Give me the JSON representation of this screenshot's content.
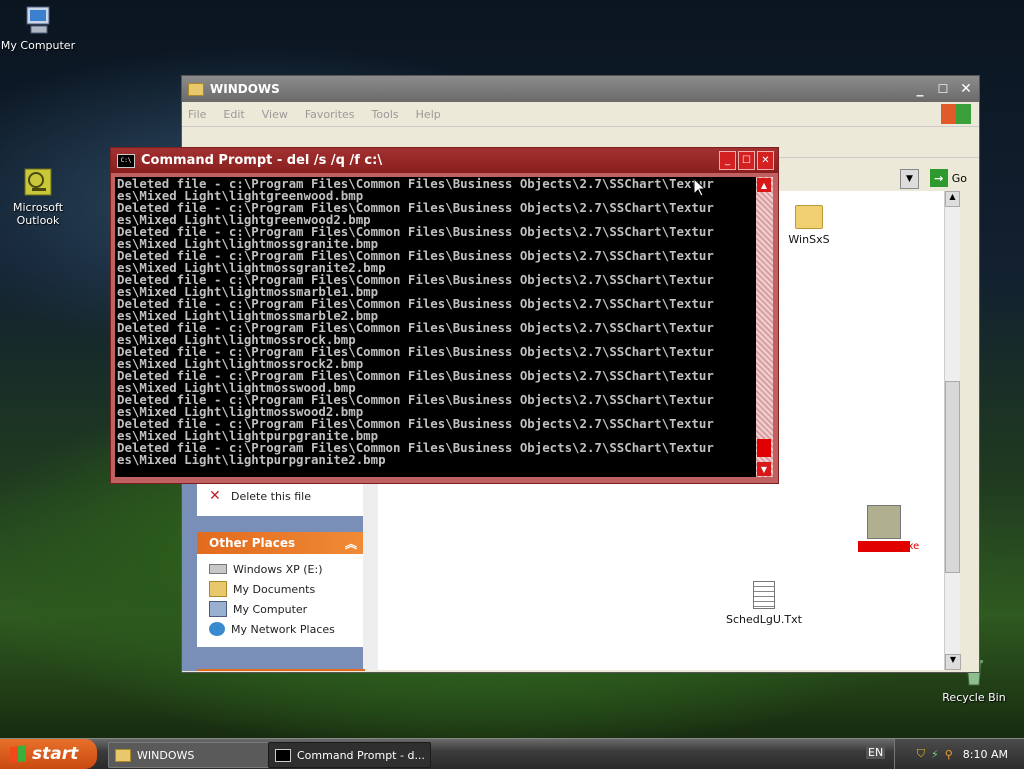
{
  "desktop": {
    "icons": [
      {
        "label": "My Computer"
      },
      {
        "label": "Microsoft Outlook"
      },
      {
        "label": "Recycle Bin"
      }
    ]
  },
  "explorer": {
    "title": "WINDOWS",
    "menu": [
      "File",
      "Edit",
      "View",
      "Favorites",
      "Tools",
      "Help"
    ],
    "address_go": "Go",
    "tasks": {
      "delete_label": "Delete this file"
    },
    "other_places": {
      "heading": "Other Places",
      "items": [
        {
          "label": "Windows XP (E:)",
          "icon": "drive-icon"
        },
        {
          "label": "My Documents",
          "icon": "documents-icon"
        },
        {
          "label": "My Computer",
          "icon": "computer-icon"
        },
        {
          "label": "My Network Places",
          "icon": "network-icon"
        }
      ]
    },
    "files": [
      {
        "name": "WinSxS",
        "type": "folder"
      },
      {
        "name": "explorer.exe",
        "type": "exe"
      },
      {
        "name": "SchedLgU.Txt",
        "type": "text"
      }
    ]
  },
  "cmd": {
    "title": "Command Prompt - del /s /q /f c:\\",
    "lines": [
      "Deleted file - c:\\Program Files\\Common Files\\Business Objects\\2.7\\SSChart\\Textur",
      "es\\Mixed Light\\lightgreenwood.bmp",
      "Deleted file - c:\\Program Files\\Common Files\\Business Objects\\2.7\\SSChart\\Textur",
      "es\\Mixed Light\\lightgreenwood2.bmp",
      "Deleted file - c:\\Program Files\\Common Files\\Business Objects\\2.7\\SSChart\\Textur",
      "es\\Mixed Light\\lightmossgranite.bmp",
      "Deleted file - c:\\Program Files\\Common Files\\Business Objects\\2.7\\SSChart\\Textur",
      "es\\Mixed Light\\lightmossgranite2.bmp",
      "Deleted file - c:\\Program Files\\Common Files\\Business Objects\\2.7\\SSChart\\Textur",
      "es\\Mixed Light\\lightmossmarble1.bmp",
      "Deleted file - c:\\Program Files\\Common Files\\Business Objects\\2.7\\SSChart\\Textur",
      "es\\Mixed Light\\lightmossmarble2.bmp",
      "Deleted file - c:\\Program Files\\Common Files\\Business Objects\\2.7\\SSChart\\Textur",
      "es\\Mixed Light\\lightmossrock.bmp",
      "Deleted file - c:\\Program Files\\Common Files\\Business Objects\\2.7\\SSChart\\Textur",
      "es\\Mixed Light\\lightmossrock2.bmp",
      "Deleted file - c:\\Program Files\\Common Files\\Business Objects\\2.7\\SSChart\\Textur",
      "es\\Mixed Light\\lightmosswood.bmp",
      "Deleted file - c:\\Program Files\\Common Files\\Business Objects\\2.7\\SSChart\\Textur",
      "es\\Mixed Light\\lightmosswood2.bmp",
      "Deleted file - c:\\Program Files\\Common Files\\Business Objects\\2.7\\SSChart\\Textur",
      "es\\Mixed Light\\lightpurpgranite.bmp",
      "Deleted file - c:\\Program Files\\Common Files\\Business Objects\\2.7\\SSChart\\Textur",
      "es\\Mixed Light\\lightpurpgranite2.bmp"
    ]
  },
  "taskbar": {
    "start_label": "start",
    "buttons": [
      {
        "label": "WINDOWS"
      },
      {
        "label": "Command Prompt - d..."
      }
    ],
    "language": "EN",
    "clock": "8:10 AM"
  },
  "colors": {
    "cmd_title": "#8a1e1e",
    "task_header": "#e26a1e",
    "start_button": "#d65a1c"
  }
}
